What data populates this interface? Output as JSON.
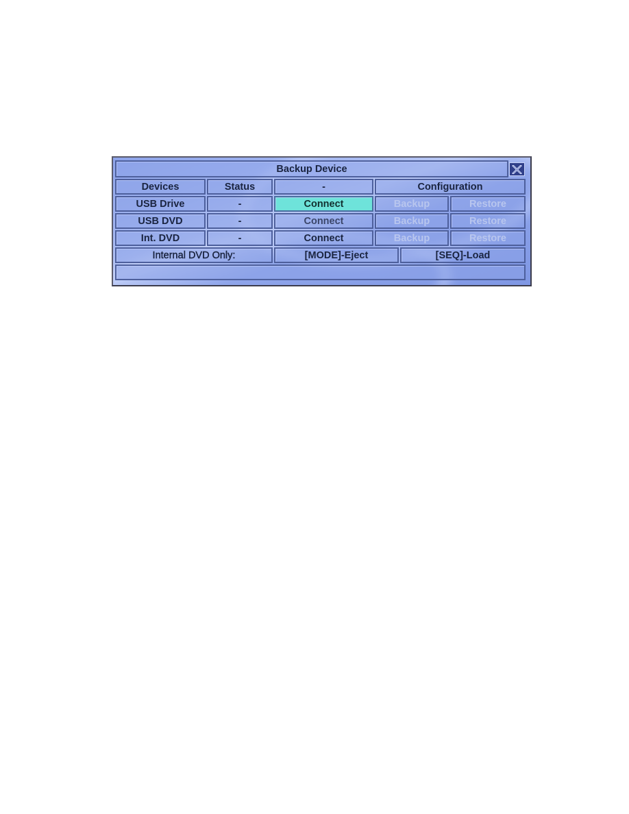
{
  "dialog": {
    "title": "Backup Device",
    "close_icon": "close-x-icon"
  },
  "header": {
    "devices": "Devices",
    "status": "Status",
    "action": "-",
    "configuration": "Configuration"
  },
  "rows": [
    {
      "device": "USB Drive",
      "status": "-",
      "connect": "Connect",
      "backup": "Backup",
      "restore": "Restore",
      "connect_state": "selected"
    },
    {
      "device": "USB DVD",
      "status": "-",
      "connect": "Connect",
      "backup": "Backup",
      "restore": "Restore",
      "connect_state": "dim"
    },
    {
      "device": "Int. DVD",
      "status": "-",
      "connect": "Connect",
      "backup": "Backup",
      "restore": "Restore",
      "connect_state": "normal"
    }
  ],
  "internal_dvd": {
    "label": "Internal DVD Only:",
    "eject": "[MODE]-Eject",
    "load": "[SEQ]-Load"
  },
  "status_bar": {
    "text": ""
  },
  "colors": {
    "selected": "#6ee3da",
    "panel": "#8ea4ea",
    "border": "#4d5f9c",
    "disabled_text": "#b9c6ee"
  }
}
